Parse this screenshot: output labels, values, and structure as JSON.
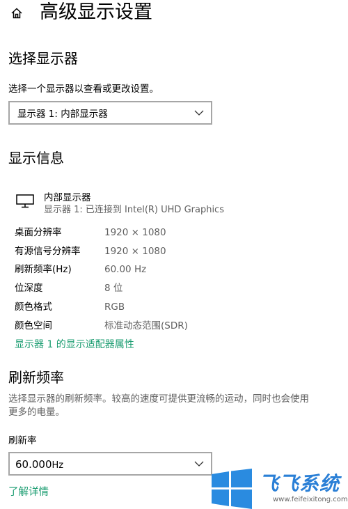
{
  "header": {
    "title": "高级显示设置",
    "home_icon": "home-icon"
  },
  "select_display": {
    "heading": "选择显示器",
    "description": "选择一个显示器以查看或更改设置。",
    "dropdown_value": "显示器 1: 内部显示器"
  },
  "display_info": {
    "heading": "显示信息",
    "monitor_name": "内部显示器",
    "monitor_sub": "显示器 1: 已连接到 Intel(R) UHD Graphics",
    "rows": [
      {
        "label": "桌面分辨率",
        "value": "1920 × 1080"
      },
      {
        "label": "有源信号分辨率",
        "value": "1920 × 1080"
      },
      {
        "label": "刷新频率(Hz)",
        "value": "60.00 Hz"
      },
      {
        "label": "位深度",
        "value": "8 位"
      },
      {
        "label": "颜色格式",
        "value": "RGB"
      },
      {
        "label": "颜色空间",
        "value": "标准动态范围(SDR)"
      }
    ],
    "adapter_link": "显示器 1 的显示适配器属性"
  },
  "refresh": {
    "heading": "刷新频率",
    "description_line1": "选择显示器的刷新频率。较高的速度可提供更流畅的运动，同时也会使用",
    "description_line2": "更多的电量。",
    "field_label": "刷新率",
    "dropdown_value": "60.000",
    "dropdown_unit": "Hz",
    "learn_more": "了解详情"
  },
  "watermark": {
    "name": "飞飞系统",
    "url": "www.feifeixitong.com"
  },
  "colors": {
    "link": "#1a9c70",
    "border": "#a6a6a6",
    "secondary_text": "#5f5f5f",
    "watermark_blue": "#2a7fd6"
  }
}
